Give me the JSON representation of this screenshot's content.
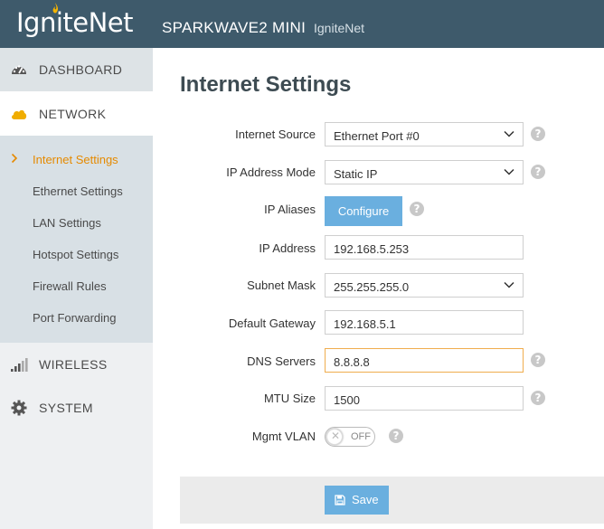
{
  "header": {
    "logo_text": "IgniteNet",
    "device_name": "SPARKWAVE2 MINI",
    "brand_name": "IgniteNet"
  },
  "sidebar": {
    "dashboard": "DASHBOARD",
    "network": "NETWORK",
    "network_items": [
      {
        "label": "Internet Settings",
        "active": true
      },
      {
        "label": "Ethernet Settings"
      },
      {
        "label": "LAN Settings"
      },
      {
        "label": "Hotspot Settings"
      },
      {
        "label": "Firewall Rules"
      },
      {
        "label": "Port Forwarding"
      }
    ],
    "wireless": "WIRELESS",
    "system": "SYSTEM"
  },
  "main": {
    "title": "Internet Settings",
    "internet_source": {
      "label": "Internet Source",
      "value": "Ethernet Port #0"
    },
    "ip_mode": {
      "label": "IP Address Mode",
      "value": "Static IP"
    },
    "ip_aliases": {
      "label": "IP Aliases",
      "button": "Configure"
    },
    "ip_address": {
      "label": "IP Address",
      "value": "192.168.5.253"
    },
    "subnet_mask": {
      "label": "Subnet Mask",
      "value": "255.255.255.0"
    },
    "gateway": {
      "label": "Default Gateway",
      "value": "192.168.5.1"
    },
    "dns": {
      "label": "DNS Servers",
      "value": "8.8.8.8"
    },
    "mtu": {
      "label": "MTU Size",
      "value": "1500"
    },
    "mgmt_vlan": {
      "label": "Mgmt VLAN",
      "state": "OFF"
    },
    "save": "Save",
    "help_glyph": "?"
  },
  "colors": {
    "header_bg": "#3e5a6b",
    "accent": "#e58a00",
    "button": "#6aafdf",
    "focus_border": "#f0ad4e"
  }
}
